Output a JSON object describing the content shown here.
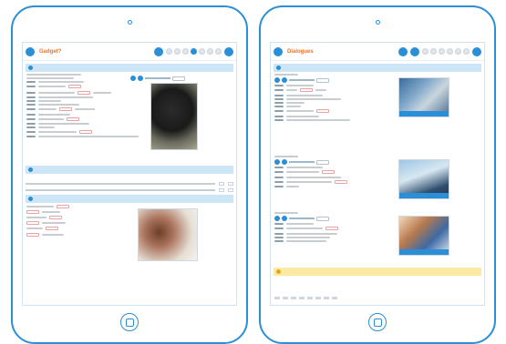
{
  "left_tablet": {
    "screen_title": "Gadget?"
  },
  "right_tablet": {
    "screen_title": "Dialogues"
  },
  "colors": {
    "accent": "#2a8fd6",
    "title_orange": "#e9752a",
    "section_blue": "#cde6f7",
    "section_yellow": "#fbe9a4"
  }
}
